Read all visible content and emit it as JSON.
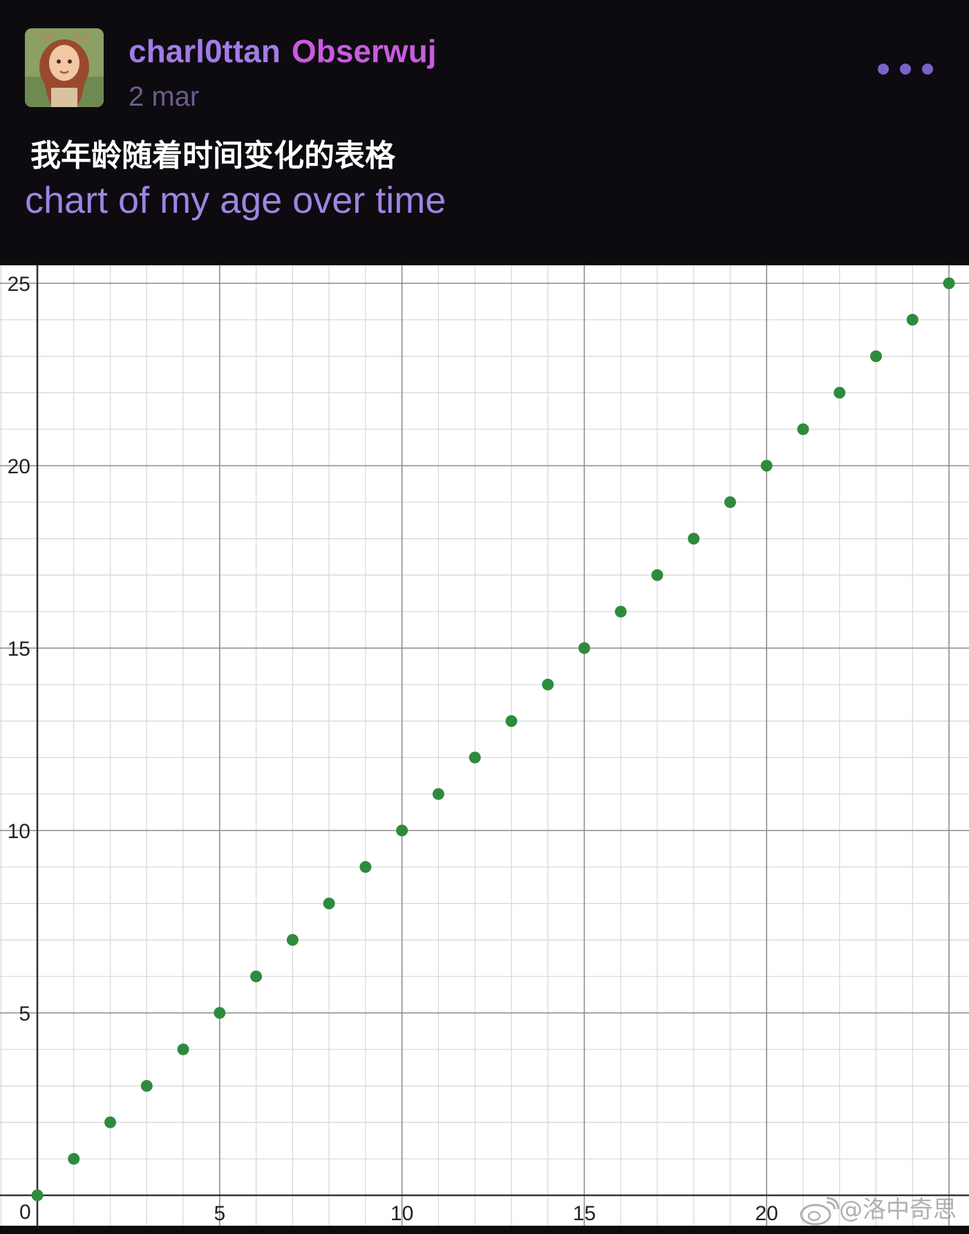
{
  "post": {
    "author": "charl0ttan",
    "author_tag": "Obserwuj",
    "date": "2 mar",
    "text_zh": "我年龄随着时间变化的表格",
    "text_en": "chart of my age over time",
    "more_icon": "more-dots-icon"
  },
  "watermark": {
    "text": "@洛中奇思",
    "icon": "weibo-icon"
  },
  "colors": {
    "background": "#0d0b0f",
    "author": "#a27be8",
    "author_tag": "#c95be0",
    "date": "#6a5e8c",
    "english_text": "#a083e4",
    "point": "#2e8b3d"
  },
  "chart_data": {
    "type": "scatter",
    "title": "",
    "xlabel": "",
    "ylabel": "",
    "xlim": [
      0,
      25
    ],
    "ylim": [
      0,
      25
    ],
    "grid": true,
    "major_ticks": [
      0,
      5,
      10,
      15,
      20,
      25
    ],
    "x_tick_labels": [
      "0",
      "5",
      "10",
      "15",
      "20"
    ],
    "y_tick_labels": [
      "5",
      "10",
      "15",
      "20",
      "25"
    ],
    "x": [
      0,
      1,
      2,
      3,
      4,
      5,
      6,
      7,
      8,
      9,
      10,
      11,
      12,
      13,
      14,
      15,
      16,
      17,
      18,
      19,
      20,
      21,
      22,
      23,
      24,
      25
    ],
    "y": [
      0,
      1,
      2,
      3,
      4,
      5,
      6,
      7,
      8,
      9,
      10,
      11,
      12,
      13,
      14,
      15,
      16,
      17,
      18,
      19,
      20,
      21,
      22,
      23,
      24,
      25
    ]
  }
}
